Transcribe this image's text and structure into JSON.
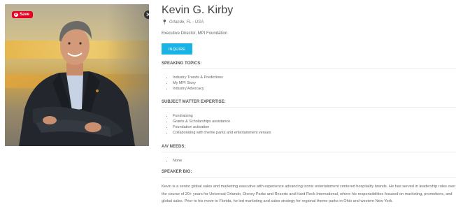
{
  "photo": {
    "save_label": "Save",
    "close_glyph": "✕",
    "pin_glyph": "P",
    "alt": "Kevin G. Kirby"
  },
  "speaker": {
    "name": "Kevin G. Kirby",
    "location": "Orlando, FL - USA",
    "location_icon": "map-marker-icon",
    "role": "Executive Director, MPI Foundation",
    "inquire_label": "INQUIRE"
  },
  "sections": {
    "topics": {
      "title": "SPEAKING TOPICS:",
      "items": [
        "Industry Trends & Predictions",
        "My MPI Story",
        "Industry Advocacy"
      ]
    },
    "expertise": {
      "title": "SUBJECT MATTER EXPERTISE:",
      "items": [
        "Fundraising",
        "Grants & Scholarships assistance",
        "Foundation activation",
        "Collaborating with theme parks and entertainment venues"
      ]
    },
    "av": {
      "title": "A/V NEEDS:",
      "items": [
        "None"
      ]
    },
    "bio": {
      "title": "SPEAKER BIO:",
      "text": "Kevin is a senior global sales and marketing executive with experience advancing iconic entertainment centered hospitality brands. He has served in leadership roles over the course of 20+ years for Universal Orlando, Disney Parks and Resorts and Hard Rock International, where his responsibilities focused on marketing, promotions, and global sales. Prior to his move to Florida, he led marketing and sales strategy for regional theme parks in Ohio and western New York."
    }
  },
  "colors": {
    "accent": "#1ab3e6",
    "save": "#e60023"
  }
}
